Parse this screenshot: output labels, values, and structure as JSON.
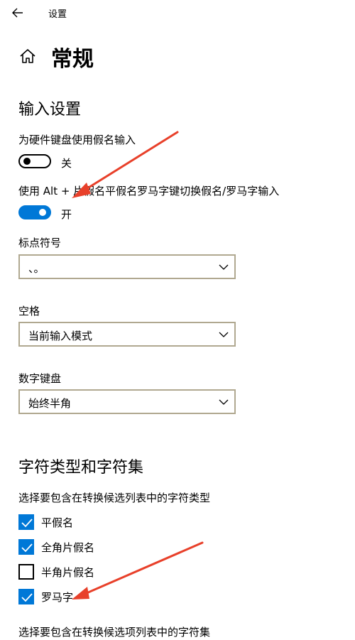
{
  "window": {
    "title": "设置"
  },
  "page": {
    "title": "常规"
  },
  "sections": {
    "input": {
      "heading": "输入设置"
    },
    "charset": {
      "heading": "字符类型和字符集"
    }
  },
  "toggles": [
    {
      "label": "为硬件键盘使用假名输入",
      "state": "关",
      "on": false
    },
    {
      "label": "使用 Alt + 片假名平假名罗马字键切换假名/罗马字输入",
      "state": "开",
      "on": true
    }
  ],
  "dropdowns": [
    {
      "label": "标点符号",
      "value": "、。"
    },
    {
      "label": "空格",
      "value": "当前输入模式"
    },
    {
      "label": "数字键盘",
      "value": "始终半角"
    }
  ],
  "char_types": {
    "description": "选择要包含在转换候选列表中的字符类型",
    "items": [
      {
        "label": "平假名",
        "checked": true
      },
      {
        "label": "全角片假名",
        "checked": true
      },
      {
        "label": "半角片假名",
        "checked": false
      },
      {
        "label": "罗马字",
        "checked": true
      }
    ]
  },
  "char_sets": {
    "description": "选择要包含在转换候选项列表中的字符集"
  },
  "colors": {
    "accent": "#0078d7",
    "annotation": "#e8402a"
  }
}
